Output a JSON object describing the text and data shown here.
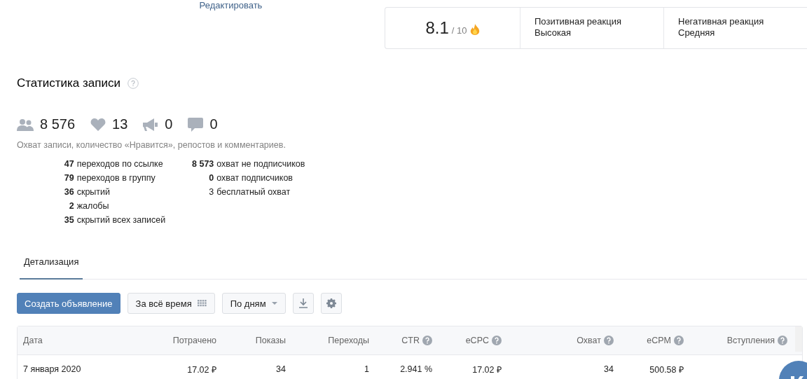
{
  "edit_link": "Редактировать",
  "rating": {
    "score": "8.1",
    "scale": "/ 10",
    "cells": [
      {
        "label": "Позитивная реакция",
        "value": "Высокая"
      },
      {
        "label": "Негативная реакция",
        "value": "Средняя"
      }
    ]
  },
  "stats_title": "Статистика записи",
  "counters": [
    {
      "kind": "reach",
      "value": "8 576"
    },
    {
      "kind": "likes",
      "value": "13"
    },
    {
      "kind": "reposts",
      "value": "0"
    },
    {
      "kind": "comments",
      "value": "0"
    }
  ],
  "description": "Охват записи, количество «Нравится», репостов и комментариев.",
  "details_left": [
    {
      "number": "47",
      "label": "переходов по ссылке"
    },
    {
      "number": "79",
      "label": "переходов в группу"
    },
    {
      "number": "36",
      "label": "скрытий"
    },
    {
      "number": "2",
      "label": "жалобы"
    },
    {
      "number": "35",
      "label": "скрытий всех записей"
    }
  ],
  "details_right": [
    {
      "number": "8 573",
      "label": "охват не подписчиков",
      "bold": true
    },
    {
      "number": "0",
      "label": "охват подписчиков",
      "bold": true
    },
    {
      "number": "3",
      "label": "бесплатный охват",
      "bold": false
    }
  ],
  "tabs": [
    {
      "label": "Детализация",
      "selected": true
    }
  ],
  "toolbar": {
    "create_button": "Создать объявление",
    "period": "За всё время",
    "grouping": "По дням"
  },
  "table": {
    "columns": [
      {
        "label": "Дата",
        "kind": "plain"
      },
      {
        "label": "Потрачено",
        "kind": "plain"
      },
      {
        "label": "Показы",
        "kind": "plain"
      },
      {
        "label": "Переходы",
        "kind": "plain"
      },
      {
        "label": "CTR",
        "kind": "with_help"
      },
      {
        "label": "eCPC",
        "kind": "with_help"
      },
      {
        "label": "Охват",
        "kind": "with_help"
      },
      {
        "label": "eCPM",
        "kind": "with_help"
      },
      {
        "label": "Вступления",
        "kind": "with_help"
      }
    ],
    "rows": [
      [
        "7 января 2020",
        "17.02 ₽",
        "34",
        "1",
        "2.941 %",
        "17.02 ₽",
        "34",
        "500.58 ₽",
        ""
      ]
    ]
  }
}
